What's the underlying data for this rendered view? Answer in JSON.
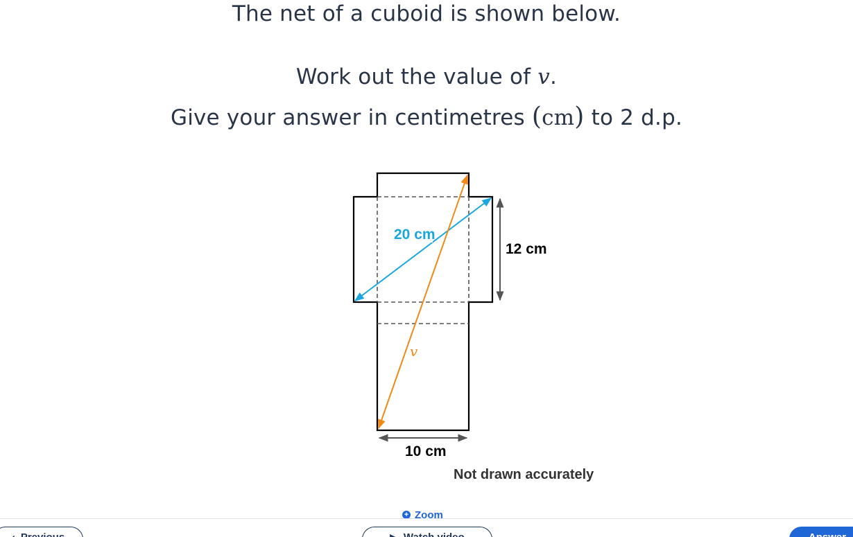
{
  "question": {
    "line1": "The net of a cuboid is shown below.",
    "line2_prefix": "Work out the value of ",
    "line2_var": "v",
    "line2_suffix": ".",
    "line3_prefix": "Give your answer in centimetres ",
    "line3_unit": "cm",
    "line3_suffix": " to 2 d.p."
  },
  "diagram": {
    "label_diagonal": "20 cm",
    "label_height": "12 cm",
    "label_width": "10 cm",
    "label_v": "v",
    "note": "Not drawn accurately",
    "colors": {
      "outline": "#000000",
      "dashed": "#555555",
      "diagonal_blue": "#1aa7e0",
      "diagonal_orange": "#f08a17",
      "measure": "#555555"
    }
  },
  "controls": {
    "zoom_label": "Zoom",
    "previous_label": "Previous",
    "watch_label": "Watch video",
    "answer_label": "Answer"
  }
}
